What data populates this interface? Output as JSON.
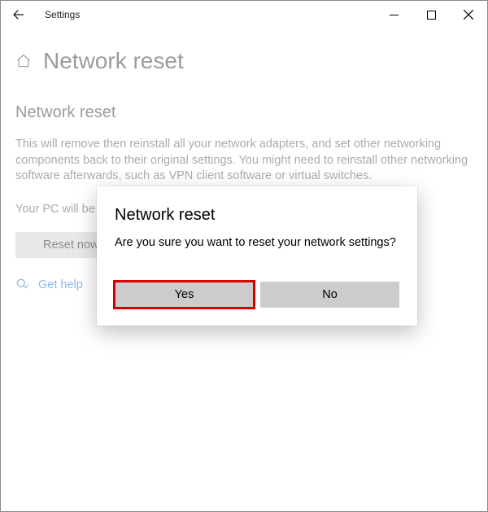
{
  "window": {
    "title": "Settings"
  },
  "page": {
    "title": "Network reset",
    "heading": "Network reset",
    "description": "This will remove then reinstall all your network adapters, and set other networking components back to their original settings. You might need to reinstall other networking software afterwards, such as VPN client software or virtual switches.",
    "restart_note": "Your PC will be restarted.",
    "reset_button": "Reset now",
    "help_link": "Get help"
  },
  "dialog": {
    "title": "Network reset",
    "message": "Are you sure you want to reset your network settings?",
    "yes": "Yes",
    "no": "No"
  }
}
